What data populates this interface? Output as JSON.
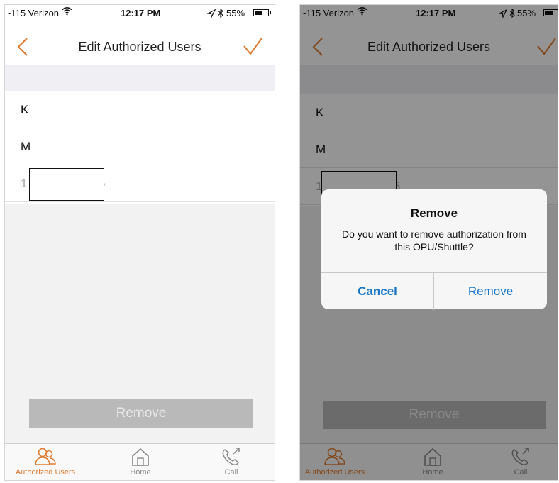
{
  "colors": {
    "accent": "#e07a2e",
    "alert_button": "#1a78c8",
    "remove_disabled": "#b9b9b9"
  },
  "status_bar": {
    "carrier": "-115 Verizon",
    "time": "12:17 PM",
    "battery": "55%",
    "battery_level": 0.55
  },
  "nav": {
    "title": "Edit Authorized Users",
    "back_icon": "chevron-left-icon",
    "confirm_icon": "checkmark-icon"
  },
  "users": [
    {
      "label": "K"
    },
    {
      "label": "M"
    },
    {
      "label_start": "1",
      "label_end": "5"
    }
  ],
  "remove_button": {
    "label": "Remove"
  },
  "tabs": [
    {
      "label": "Authorized Users",
      "icon": "users-icon",
      "active": true
    },
    {
      "label": "Home",
      "icon": "home-icon",
      "active": false
    },
    {
      "label": "Call",
      "icon": "phone-call-icon",
      "active": false
    }
  ],
  "alert": {
    "title": "Remove",
    "message": "Do you want to remove authorization from this OPU/Shuttle?",
    "cancel_label": "Cancel",
    "confirm_label": "Remove"
  }
}
